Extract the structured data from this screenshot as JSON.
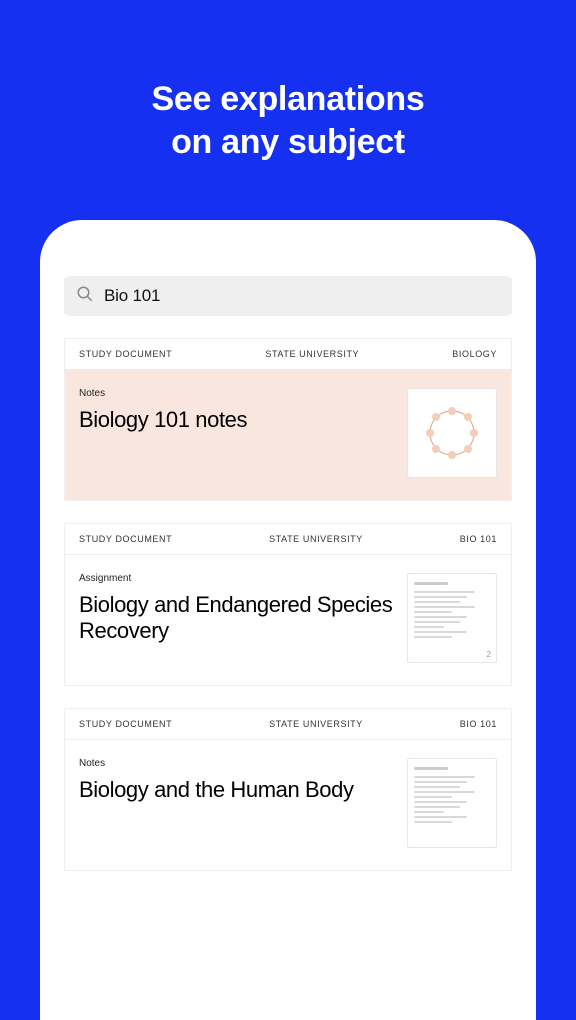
{
  "headline_line1": "See explanations",
  "headline_line2": "on any subject",
  "search": {
    "query": "Bio 101"
  },
  "cards": [
    {
      "header": {
        "type": "STUDY DOCUMENT",
        "source": "STATE UNIVERSITY",
        "subject": "BIOLOGY"
      },
      "doc_type": "Notes",
      "title": "Biology 101 notes",
      "style": "pink",
      "thumb": "ring"
    },
    {
      "header": {
        "type": "STUDY DOCUMENT",
        "source": "STATE UNIVERSITY",
        "subject": "BIO 101"
      },
      "doc_type": "Assignment",
      "title": "Biology and Endangered Species Recovery",
      "style": "plain",
      "thumb": "doc",
      "page_count": "2"
    },
    {
      "header": {
        "type": "STUDY DOCUMENT",
        "source": "STATE UNIVERSITY",
        "subject": "BIO 101"
      },
      "doc_type": "Notes",
      "title": "Biology and the Human Body",
      "style": "plain",
      "thumb": "doc"
    }
  ]
}
